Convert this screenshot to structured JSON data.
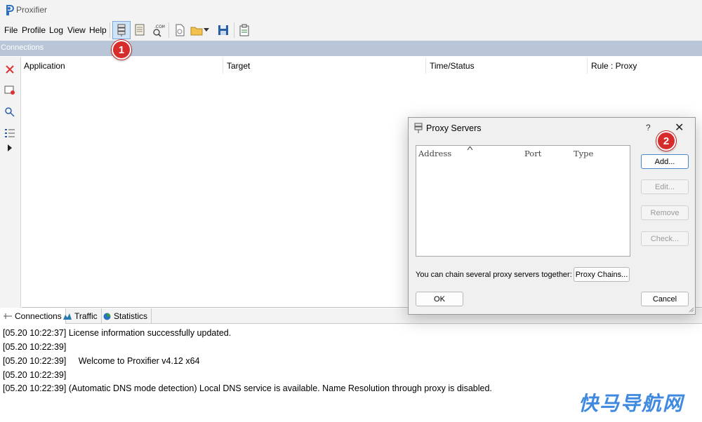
{
  "window": {
    "title": "Proxifier"
  },
  "menu": [
    "File",
    "Profile",
    "Log",
    "View",
    "Help"
  ],
  "toolbar": {
    "icons": [
      "proxy-servers-icon",
      "proxification-rules-icon",
      "name-resolution-icon",
      "new-profile-icon",
      "open-profile-icon",
      "save-profile-icon",
      "clipboard-icon"
    ]
  },
  "connections_bar": {
    "label": "Connections"
  },
  "table": {
    "columns": [
      "Application",
      "Target",
      "Time/Status",
      "Rule : Proxy"
    ]
  },
  "bottom_tabs": [
    "Connections",
    "Traffic",
    "Statistics"
  ],
  "log": [
    "[05.20 10:22:37] License information successfully updated.",
    "[05.20 10:22:39]",
    "[05.20 10:22:39]     Welcome to Proxifier v4.12 x64",
    "[05.20 10:22:39]",
    "[05.20 10:22:39] (Automatic DNS mode detection) Local DNS service is available. Name Resolution through proxy is disabled."
  ],
  "dialog": {
    "title": "Proxy Servers",
    "help": "?",
    "close": "✕",
    "list_columns": [
      "Address",
      "Port",
      "Type"
    ],
    "buttons": {
      "add": "Add...",
      "edit": "Edit...",
      "remove": "Remove",
      "check": "Check...",
      "proxy_chains": "Proxy Chains...",
      "ok": "OK",
      "cancel": "Cancel"
    },
    "chain_text": "You can chain several proxy servers together:"
  },
  "callouts": [
    "1",
    "2"
  ],
  "watermark": "快马导航网",
  "colors": {
    "accent": "#4a86c7",
    "callout": "#d62c2c",
    "connections_bar": "#b8c6d8"
  }
}
